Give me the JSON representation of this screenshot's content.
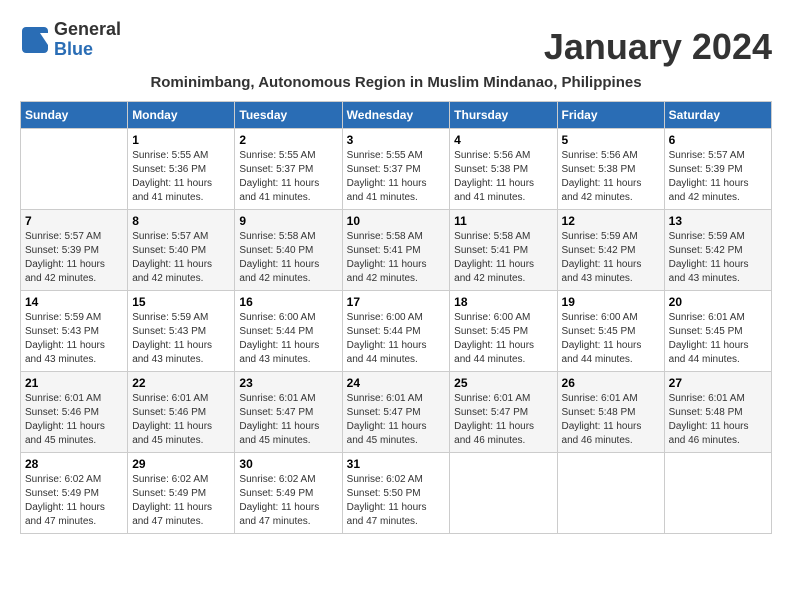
{
  "logo": {
    "line1": "General",
    "line2": "Blue"
  },
  "title": "January 2024",
  "subtitle": "Rominimbang, Autonomous Region in Muslim Mindanao, Philippines",
  "days_of_week": [
    "Sunday",
    "Monday",
    "Tuesday",
    "Wednesday",
    "Thursday",
    "Friday",
    "Saturday"
  ],
  "weeks": [
    [
      {
        "day": "",
        "sunrise": "",
        "sunset": "",
        "daylight": ""
      },
      {
        "day": "1",
        "sunrise": "5:55 AM",
        "sunset": "5:36 PM",
        "daylight": "11 hours and 41 minutes."
      },
      {
        "day": "2",
        "sunrise": "5:55 AM",
        "sunset": "5:37 PM",
        "daylight": "11 hours and 41 minutes."
      },
      {
        "day": "3",
        "sunrise": "5:55 AM",
        "sunset": "5:37 PM",
        "daylight": "11 hours and 41 minutes."
      },
      {
        "day": "4",
        "sunrise": "5:56 AM",
        "sunset": "5:38 PM",
        "daylight": "11 hours and 41 minutes."
      },
      {
        "day": "5",
        "sunrise": "5:56 AM",
        "sunset": "5:38 PM",
        "daylight": "11 hours and 42 minutes."
      },
      {
        "day": "6",
        "sunrise": "5:57 AM",
        "sunset": "5:39 PM",
        "daylight": "11 hours and 42 minutes."
      }
    ],
    [
      {
        "day": "7",
        "sunrise": "5:57 AM",
        "sunset": "5:39 PM",
        "daylight": "11 hours and 42 minutes."
      },
      {
        "day": "8",
        "sunrise": "5:57 AM",
        "sunset": "5:40 PM",
        "daylight": "11 hours and 42 minutes."
      },
      {
        "day": "9",
        "sunrise": "5:58 AM",
        "sunset": "5:40 PM",
        "daylight": "11 hours and 42 minutes."
      },
      {
        "day": "10",
        "sunrise": "5:58 AM",
        "sunset": "5:41 PM",
        "daylight": "11 hours and 42 minutes."
      },
      {
        "day": "11",
        "sunrise": "5:58 AM",
        "sunset": "5:41 PM",
        "daylight": "11 hours and 42 minutes."
      },
      {
        "day": "12",
        "sunrise": "5:59 AM",
        "sunset": "5:42 PM",
        "daylight": "11 hours and 43 minutes."
      },
      {
        "day": "13",
        "sunrise": "5:59 AM",
        "sunset": "5:42 PM",
        "daylight": "11 hours and 43 minutes."
      }
    ],
    [
      {
        "day": "14",
        "sunrise": "5:59 AM",
        "sunset": "5:43 PM",
        "daylight": "11 hours and 43 minutes."
      },
      {
        "day": "15",
        "sunrise": "5:59 AM",
        "sunset": "5:43 PM",
        "daylight": "11 hours and 43 minutes."
      },
      {
        "day": "16",
        "sunrise": "6:00 AM",
        "sunset": "5:44 PM",
        "daylight": "11 hours and 43 minutes."
      },
      {
        "day": "17",
        "sunrise": "6:00 AM",
        "sunset": "5:44 PM",
        "daylight": "11 hours and 44 minutes."
      },
      {
        "day": "18",
        "sunrise": "6:00 AM",
        "sunset": "5:45 PM",
        "daylight": "11 hours and 44 minutes."
      },
      {
        "day": "19",
        "sunrise": "6:00 AM",
        "sunset": "5:45 PM",
        "daylight": "11 hours and 44 minutes."
      },
      {
        "day": "20",
        "sunrise": "6:01 AM",
        "sunset": "5:45 PM",
        "daylight": "11 hours and 44 minutes."
      }
    ],
    [
      {
        "day": "21",
        "sunrise": "6:01 AM",
        "sunset": "5:46 PM",
        "daylight": "11 hours and 45 minutes."
      },
      {
        "day": "22",
        "sunrise": "6:01 AM",
        "sunset": "5:46 PM",
        "daylight": "11 hours and 45 minutes."
      },
      {
        "day": "23",
        "sunrise": "6:01 AM",
        "sunset": "5:47 PM",
        "daylight": "11 hours and 45 minutes."
      },
      {
        "day": "24",
        "sunrise": "6:01 AM",
        "sunset": "5:47 PM",
        "daylight": "11 hours and 45 minutes."
      },
      {
        "day": "25",
        "sunrise": "6:01 AM",
        "sunset": "5:47 PM",
        "daylight": "11 hours and 46 minutes."
      },
      {
        "day": "26",
        "sunrise": "6:01 AM",
        "sunset": "5:48 PM",
        "daylight": "11 hours and 46 minutes."
      },
      {
        "day": "27",
        "sunrise": "6:01 AM",
        "sunset": "5:48 PM",
        "daylight": "11 hours and 46 minutes."
      }
    ],
    [
      {
        "day": "28",
        "sunrise": "6:02 AM",
        "sunset": "5:49 PM",
        "daylight": "11 hours and 47 minutes."
      },
      {
        "day": "29",
        "sunrise": "6:02 AM",
        "sunset": "5:49 PM",
        "daylight": "11 hours and 47 minutes."
      },
      {
        "day": "30",
        "sunrise": "6:02 AM",
        "sunset": "5:49 PM",
        "daylight": "11 hours and 47 minutes."
      },
      {
        "day": "31",
        "sunrise": "6:02 AM",
        "sunset": "5:50 PM",
        "daylight": "11 hours and 47 minutes."
      },
      {
        "day": "",
        "sunrise": "",
        "sunset": "",
        "daylight": ""
      },
      {
        "day": "",
        "sunrise": "",
        "sunset": "",
        "daylight": ""
      },
      {
        "day": "",
        "sunrise": "",
        "sunset": "",
        "daylight": ""
      }
    ]
  ]
}
